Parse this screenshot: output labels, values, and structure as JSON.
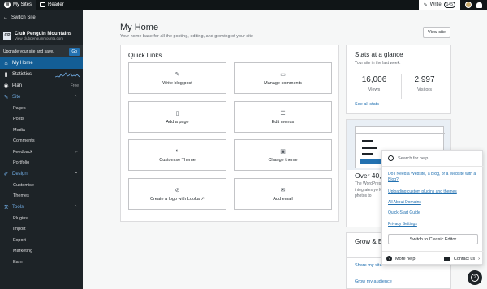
{
  "topbar": {
    "my_sites": "My Sites",
    "reader": "Reader",
    "write": "Write",
    "write_count": "145"
  },
  "sidebar": {
    "switch_site": "Switch Site",
    "site_name": "Club Penguin Mountains",
    "site_url": "View clubpenguinmounta.com",
    "upgrade_text": "Upgrade your site and save.",
    "upgrade_button": "Go",
    "items": {
      "my_home": "My Home",
      "stats": "Statistics",
      "plan": "Plan",
      "plan_badge": "Free",
      "site": "Site",
      "design": "Design",
      "tools": "Tools"
    },
    "site_sub": [
      "Pages",
      "Posts",
      "Media",
      "Comments",
      "Feedback",
      "Portfolio"
    ],
    "design_sub": [
      "Customise",
      "Themes"
    ],
    "tools_sub": [
      "Plugins",
      "Import",
      "Export",
      "Marketing",
      "Earn"
    ]
  },
  "main": {
    "title": "My Home",
    "subtitle": "Your home base for all the posting, editing, and growing of your site",
    "view_site": "View site"
  },
  "quick_links": {
    "title": "Quick Links",
    "items": [
      {
        "label": "Write blog post",
        "icon": "pencil-icon"
      },
      {
        "label": "Manage comments",
        "icon": "comment-icon"
      },
      {
        "label": "Add a page",
        "icon": "page-icon"
      },
      {
        "label": "Edit menus",
        "icon": "menu-icon"
      },
      {
        "label": "Customise Theme",
        "icon": "palette-icon"
      },
      {
        "label": "Change theme",
        "icon": "layout-icon"
      },
      {
        "label": "Create a logo with Looka ↗",
        "icon": "logo-icon"
      },
      {
        "label": "Add email",
        "icon": "mail-icon"
      }
    ]
  },
  "stats": {
    "title": "Stats at a glance",
    "subtitle": "Your site in the last week.",
    "views": "16,006",
    "views_label": "Views",
    "visitors": "2,997",
    "visitors_label": "Visitors",
    "see_all": "See all stats"
  },
  "promo": {
    "title": "Over 40,0",
    "text": "The WordPress integrates yo few photos to"
  },
  "grow": {
    "title": "Grow & Ea",
    "share": "Share my site",
    "audience": "Grow my audience"
  },
  "help": {
    "search_placeholder": "Search for help...",
    "links": [
      "Do I Need a Website, a Blog, or a Website with a Blog?",
      "Uploading custom plugins and themes",
      "All About Domains",
      "Quick-Start Guide",
      "Privacy Settings"
    ],
    "classic_editor": "Switch to Classic Editor",
    "more_help": "More help",
    "contact_us": "Contact us"
  },
  "colors": {
    "sidebar_bg": "#1d2327",
    "active": "#135e96",
    "link": "#2271b1"
  }
}
